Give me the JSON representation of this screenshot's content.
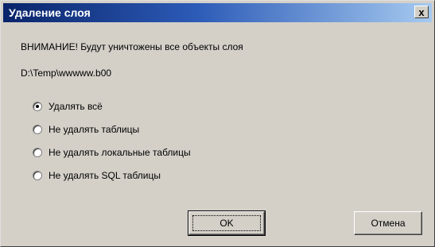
{
  "window": {
    "title": "Удаление слоя",
    "close_label": "x"
  },
  "message": "ВНИМАНИЕ! Будут уничтожены все объекты слоя",
  "path": "D:\\Temp\\wwwww.b00",
  "options": [
    {
      "label": "Удалять всё",
      "selected": true
    },
    {
      "label": "Не удалять таблицы",
      "selected": false
    },
    {
      "label": "Не удалять локальные таблицы",
      "selected": false
    },
    {
      "label": "Не удалять SQL таблицы",
      "selected": false
    }
  ],
  "buttons": {
    "ok": "OK",
    "cancel": "Отмена"
  },
  "colors": {
    "titlebar_start": "#0a246a",
    "titlebar_end": "#a6caf0",
    "face": "#d4d0c8"
  }
}
